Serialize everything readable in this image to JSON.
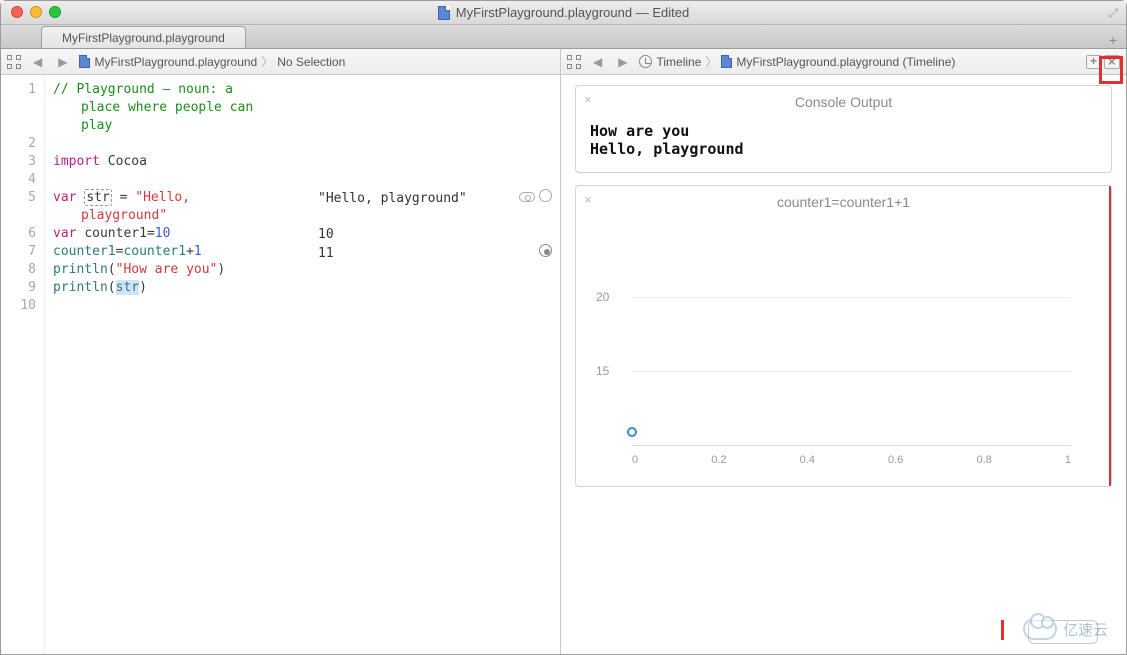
{
  "window": {
    "title": "MyFirstPlayground.playground — Edited"
  },
  "tab": {
    "label": "MyFirstPlayground.playground"
  },
  "jumpbar": {
    "left_file": "MyFirstPlayground.playground",
    "left_selection": "No Selection",
    "right_timeline": "Timeline",
    "right_file": "MyFirstPlayground.playground (Timeline)"
  },
  "gutter": [
    "1",
    "2",
    "3",
    "4",
    "5",
    "6",
    "7",
    "8",
    "9",
    "10"
  ],
  "code": {
    "l1a": "// Playground – noun: a",
    "l1b": "place where people can",
    "l1c": "play",
    "l3_kw": "import",
    "l3_id": "Cocoa",
    "l5_kw": "var",
    "l5_name": "str",
    "l5_eq": " = ",
    "l5_strA": "\"Hello,",
    "l5_strB": "playground\"",
    "l6_kw": "var",
    "l6_name": "counter1",
    "l6_eq": "=",
    "l6_val": "10",
    "l7_lhs": "counter1",
    "l7_eq": "=",
    "l7_rhs": "counter1",
    "l7_plus": "+",
    "l7_one": "1",
    "l8_fn": "println",
    "l8_arg": "\"How are you\"",
    "l9_fn": "println",
    "l9_arg": "str"
  },
  "results": {
    "r5": "\"Hello, playground\"",
    "r6": "10",
    "r7": "11"
  },
  "console": {
    "title": "Console Output",
    "line1": "How are you",
    "line2": "Hello, playground"
  },
  "chart_data": {
    "type": "scatter",
    "title": "counter1=counter1+1",
    "xlabel": "",
    "ylabel": "",
    "xlim": [
      0,
      1
    ],
    "ylim": [
      10,
      22
    ],
    "xticks": [
      "0",
      "0.2",
      "0.4",
      "0.6",
      "0.8",
      "1"
    ],
    "yticks": [
      {
        "v": 15,
        "label": "15"
      },
      {
        "v": 20,
        "label": "20"
      }
    ],
    "series": [
      {
        "name": "counter1",
        "points": [
          {
            "x": 0,
            "y": 11
          }
        ]
      }
    ]
  }
}
